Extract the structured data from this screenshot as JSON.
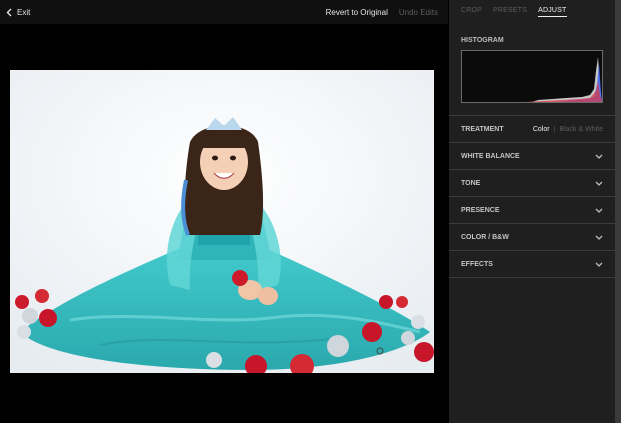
{
  "topbar": {
    "exit_label": "Exit",
    "revert_label": "Revert to Original",
    "undo_label": "Undo Edits"
  },
  "tabs": [
    {
      "label": "CROP",
      "active": false
    },
    {
      "label": "PRESETS",
      "active": false
    },
    {
      "label": "ADJUST",
      "active": true
    }
  ],
  "histogram": {
    "label": "HISTOGRAM"
  },
  "treatment": {
    "label": "TREATMENT",
    "options": [
      "Color",
      "Black & White"
    ],
    "selected": "Color"
  },
  "sections": [
    {
      "label": "WHITE BALANCE",
      "icon": "chevron-down-icon"
    },
    {
      "label": "TONE",
      "icon": "chevron-down-icon"
    },
    {
      "label": "PRESENCE",
      "icon": "chevron-down-icon"
    },
    {
      "label": "COLOR / B&W",
      "icon": "chevron-down-icon"
    },
    {
      "label": "EFFECTS",
      "icon": "chevron-down-icon"
    }
  ],
  "colors": {
    "panel_bg": "#1f1f1f",
    "canvas_bg": "#000000",
    "dress": "#3ec6c8"
  }
}
